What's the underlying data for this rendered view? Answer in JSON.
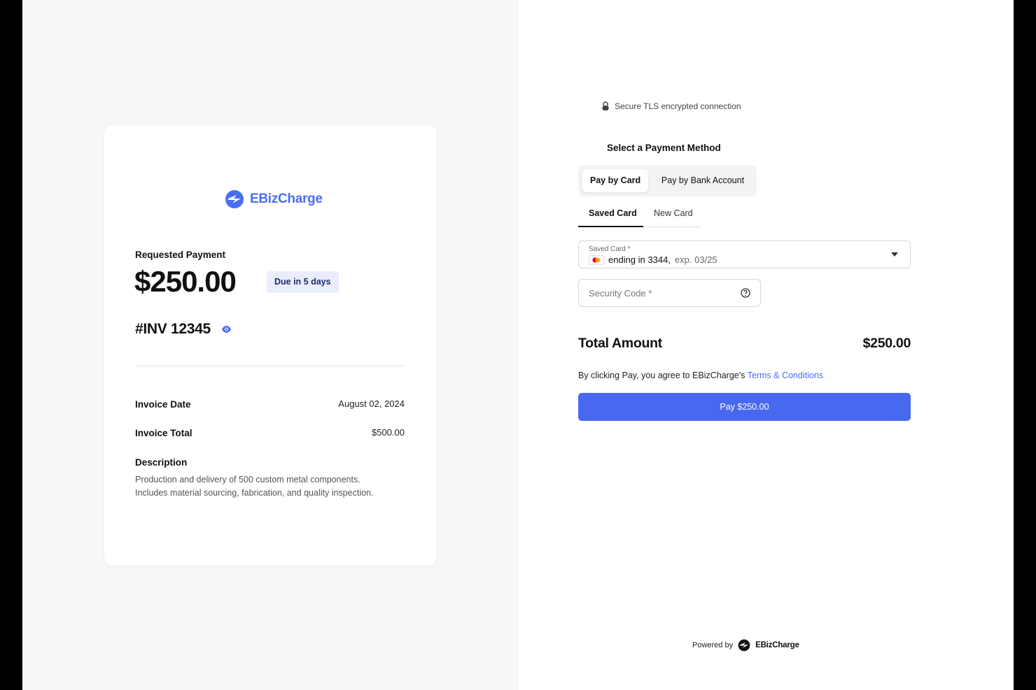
{
  "brand": {
    "name": "EBizCharge",
    "accent_color": "#4a6cf7",
    "logo_icon": "ebizcharge-logo-icon"
  },
  "invoice": {
    "requested_label": "Requested Payment",
    "amount": "$250.00",
    "due_badge": "Due in 5 days",
    "number": "#INV 12345",
    "view_icon": "eye-icon",
    "rows": [
      {
        "label": "Invoice Date",
        "value": "August 02, 2024"
      },
      {
        "label": "Invoice Total",
        "value": "$500.00"
      }
    ],
    "description_label": "Description",
    "description_line1": "Production and delivery of 500 custom metal components.",
    "description_line2": "Includes material sourcing, fabrication, and quality inspection."
  },
  "payment": {
    "secure_icon": "lock-icon",
    "secure_text": "Secure TLS encrypted connection",
    "section_title": "Select a Payment Method",
    "methods": [
      {
        "label": "Pay by Card",
        "active": true
      },
      {
        "label": "Pay by Bank Account",
        "active": false
      }
    ],
    "card_tabs": [
      {
        "label": "Saved Card",
        "active": true
      },
      {
        "label": "New Card",
        "active": false
      }
    ],
    "saved_card": {
      "label": "Saved Card *",
      "icon": "mastercard-icon",
      "ending": "ending in 3344,",
      "expiry": "exp. 03/25"
    },
    "security_code": {
      "placeholder": "Security Code *",
      "help_icon": "help-circle-icon"
    },
    "total_label": "Total Amount",
    "total_value": "$250.00",
    "agree_text": "By clicking Pay, you agree to EBizCharge's",
    "terms_link": "Terms & Conditions",
    "pay_button": "Pay $250.00",
    "button_color": "#4869ef"
  },
  "footer": {
    "powered_by": "Powered by",
    "brand": "EBizCharge"
  }
}
